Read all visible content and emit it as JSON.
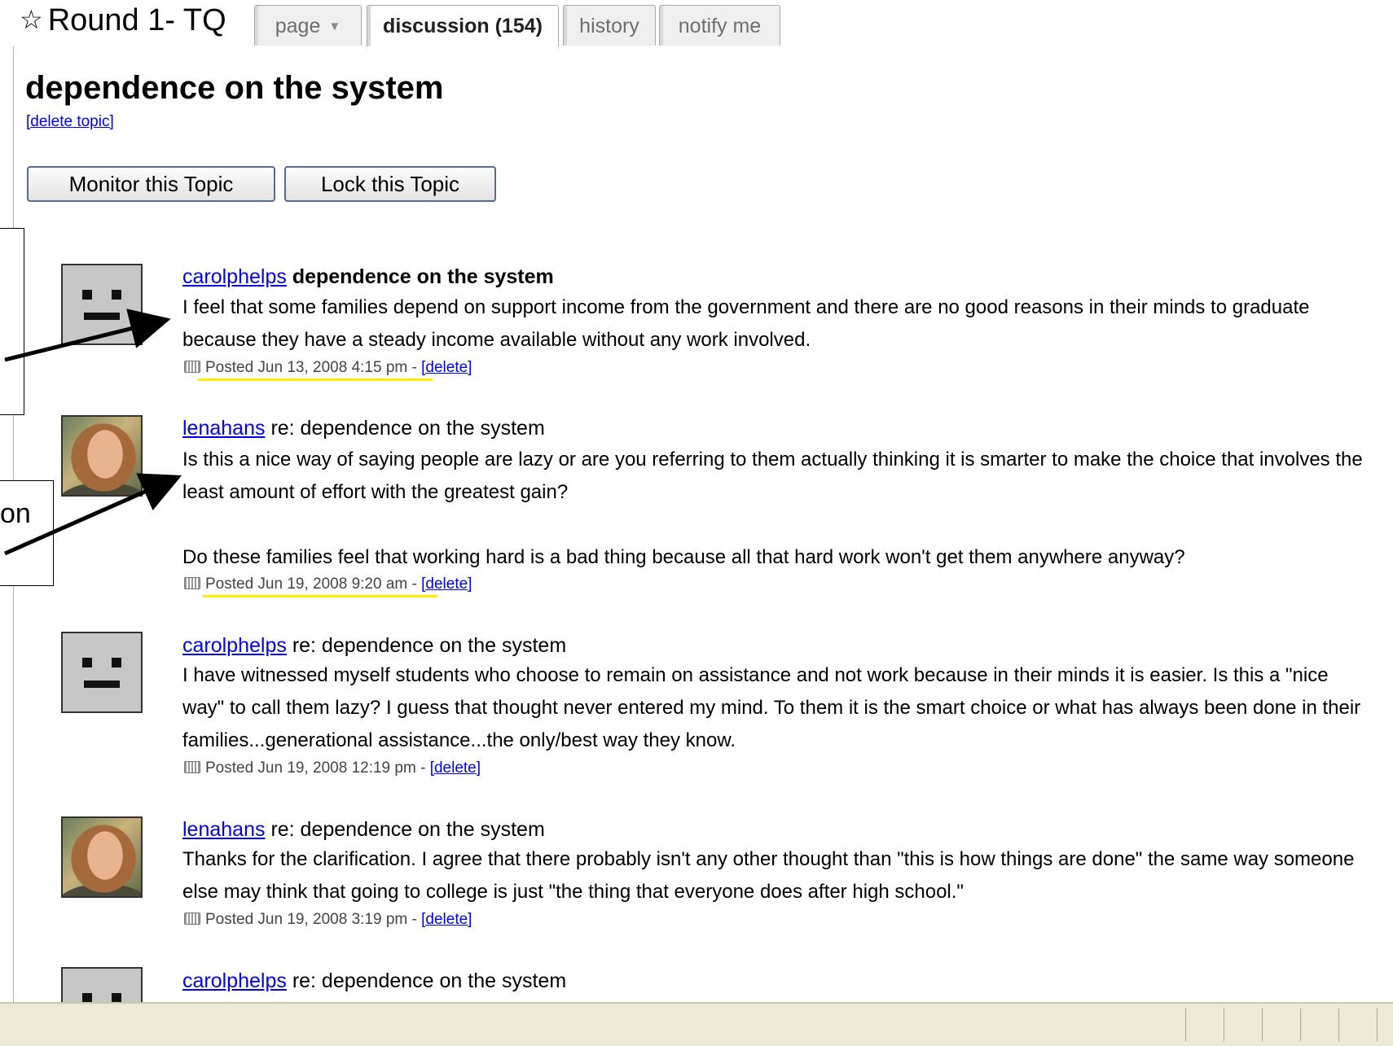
{
  "wiki": {
    "title": "Round 1- TQ",
    "tabs": [
      {
        "label": "page"
      },
      {
        "label": "discussion (154)"
      },
      {
        "label": "history"
      },
      {
        "label": "notify me"
      }
    ]
  },
  "topic": {
    "title": "dependence on the system",
    "delete_link": "[delete topic]",
    "buttons": {
      "monitor": "Monitor this Topic",
      "lock": "Lock this Topic"
    }
  },
  "posts": [
    {
      "author": "carolphelps",
      "subject": "dependence on the system",
      "avatar": "face-placeholder",
      "paragraphs": [
        "I feel that some families depend on support income from the government and there are no good reasons in their minds to graduate because they have a steady income available without any work involved."
      ],
      "posted": "Posted Jun 13, 2008 4:15 pm",
      "sep": " - ",
      "delete": "[delete]"
    },
    {
      "author": "lenahans",
      "subject": "re: dependence on the system",
      "avatar": "photo",
      "paragraphs": [
        "Is this a nice way of saying people are lazy or are you referring to them actually thinking it is smarter to make the choice that involves the least amount of effort with the greatest gain?",
        "Do these families feel that working hard is a bad thing because all that hard work won't get them anywhere anyway?"
      ],
      "posted": "Posted Jun 19, 2008 9:20 am",
      "sep": " - ",
      "delete": "[delete]"
    },
    {
      "author": "carolphelps",
      "subject": "re: dependence on the system",
      "avatar": "face-placeholder",
      "paragraphs": [
        "I have witnessed myself students who choose to remain on assistance and not work because in their minds it is easier. Is this a \"nice way\" to call them lazy? I guess that thought never entered my mind. To them it is the smart choice or what has always been done in their families...generational assistance...the only/best way they know."
      ],
      "posted": "Posted Jun 19, 2008 12:19 pm",
      "sep": " - ",
      "delete": "[delete]"
    },
    {
      "author": "lenahans",
      "subject": "re: dependence on the system",
      "avatar": "photo",
      "paragraphs": [
        "Thanks for the clarification. I agree that there probably isn't any other thought than \"this is how things are done\" the same way someone else may think that going to college is just \"the thing that everyone does after high school.\""
      ],
      "posted": "Posted Jun 19, 2008 3:19 pm",
      "sep": " - ",
      "delete": "[delete]"
    },
    {
      "author": "carolphelps",
      "subject": "re: dependence on the system",
      "avatar": "face-placeholder",
      "paragraphs": [],
      "posted": "",
      "sep": "",
      "delete": ""
    }
  ],
  "annotations": {
    "callout_2_text": "on",
    "highlight_color": "#ffee00",
    "arrow_color": "#000000"
  },
  "colors": {
    "link": "#0000ee",
    "statusbar": "#ece9d8"
  }
}
